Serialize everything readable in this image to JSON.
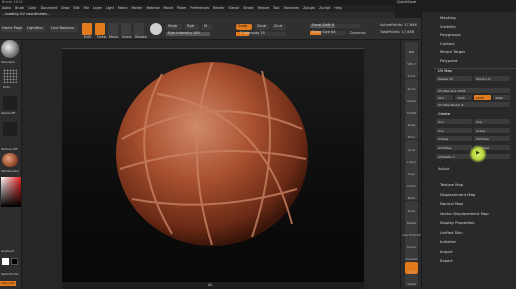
{
  "app": {
    "title": "Brush 2019",
    "notice": "...loading UV coordinates...",
    "brand_color": "#e07a1c"
  },
  "menubar": {
    "items": [
      "Alpha",
      "Brush",
      "Color",
      "Document",
      "Draw",
      "Edit",
      "File",
      "Layer",
      "Light",
      "Macro",
      "Marker",
      "Material",
      "Movie",
      "Picker",
      "Preferences",
      "Render",
      "Stencil",
      "Stroke",
      "Texture",
      "Tool",
      "Transform",
      "Zplugin",
      "Zscript",
      "Help"
    ],
    "quicksave": "QuickSave",
    "see_through": "See-through 0",
    "menus": "Menus",
    "default_script": "DefaultZScript"
  },
  "toolbar": {
    "home_page": "Home Page",
    "lightbox": "LightBox",
    "live_boolean": "Live Boolean",
    "edit": "Edit",
    "draw": "Draw",
    "move": "Move",
    "scale": "Scale",
    "rotate": "Rotate",
    "mrgb": "Mrgb",
    "rgb": "Rgb",
    "m": "M",
    "zadd": "Zadd",
    "zsub": "Zsub",
    "zcut": "Zcut",
    "rgb_intensity": "Rgb Intensity 100",
    "z_intensity": "Z Intensity 25",
    "focal_shift": "Focal Shift 0",
    "draw_size": "Draw Size 64",
    "dynamic": "Dynamic",
    "active_points": "ActivePoints: 17,646",
    "total_points": "TotalPoints: 17,646"
  },
  "left_shelf": {
    "standard": "Standard",
    "dots": "Dots",
    "alpha_off": "Alpha Off",
    "texture_off": "Texture Off",
    "skin_shade": "SkinShade4",
    "gradient": "Gradient",
    "switch_color": "SwitchColor",
    "alternate": "Alternate"
  },
  "right_shelf": {
    "buttons": [
      "BPR",
      "SPix 3",
      "Scroll",
      "Zoom",
      "Actual",
      "AAHalf",
      "Persp",
      "Floor",
      "Local",
      "L.Sym",
      "Gxyz",
      "Frame",
      "Move",
      "Scale",
      "Rotate",
      "Line Fill PolyF",
      "Transp",
      "Dynamic",
      "Solo",
      "Xpose"
    ]
  },
  "palette": {
    "top_items": [
      "Masking",
      "Visibility",
      "Polygroups",
      "Contact",
      "Morph Target",
      "Polypaint"
    ],
    "uv_map_header": "UV Map",
    "delete_uv": "Delete UV",
    "morph_uv": "Morph UV",
    "uv_map_size": "UV Map Size 2048",
    "sizes": [
      "512",
      "1024",
      "2048",
      "4096"
    ],
    "uv_map_border": "UV Map Border 8",
    "create_header": "Create",
    "create_buttons": [
      "Uvc",
      "Uvp",
      "Uvs",
      "Uvbox",
      "Uvtiles",
      "PUVTiles",
      "GUVTiles",
      "AUVTiles"
    ],
    "auv_ratio": "AUVRatio 1",
    "adjust": "Adjust",
    "bottom_items": [
      "Texture Map",
      "Displacement Map",
      "Normal Map",
      "Vector Displacement Map",
      "Display Properties",
      "Unified Skin",
      "Initialize",
      "Import",
      "Export"
    ]
  },
  "viewport": {
    "bottom_label": "AC"
  }
}
